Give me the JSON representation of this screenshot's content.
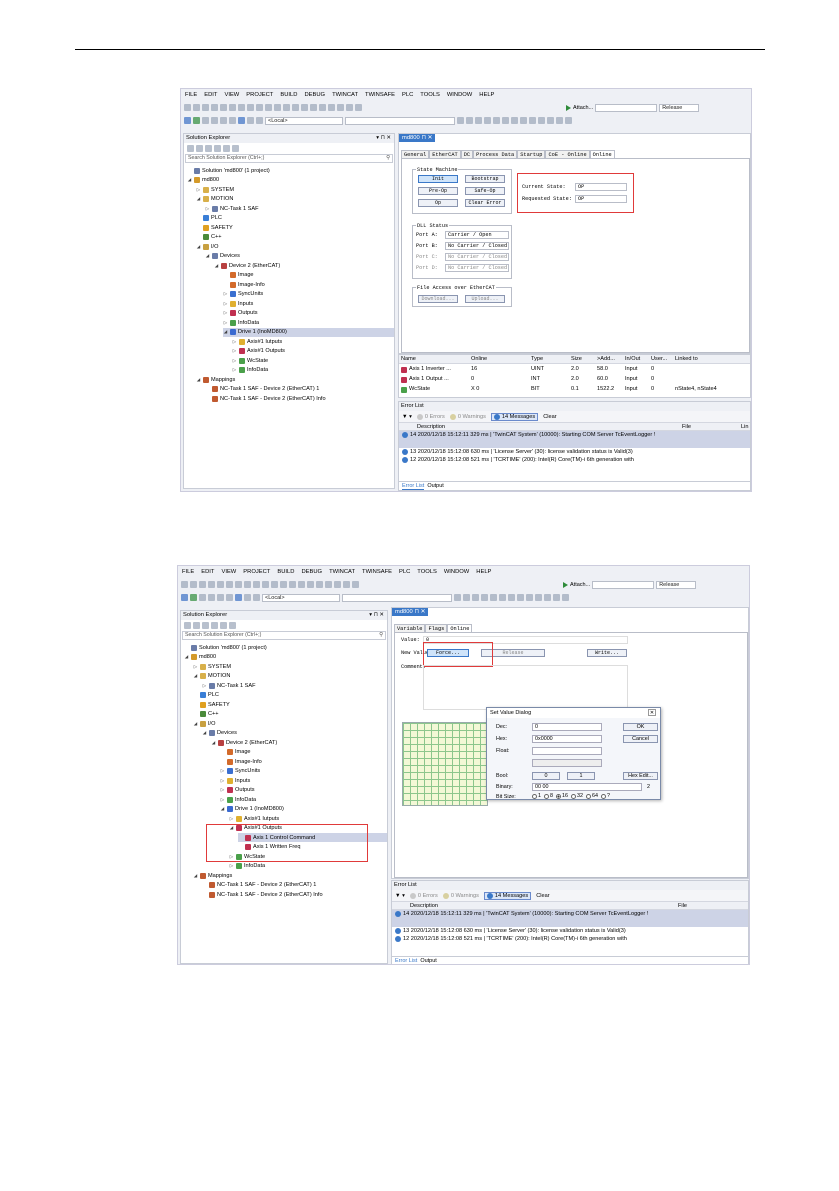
{
  "menu": [
    "FILE",
    "EDIT",
    "VIEW",
    "PROJECT",
    "BUILD",
    "DEBUG",
    "TWINCAT",
    "TWINSAFE",
    "PLC",
    "TOOLS",
    "WINDOW",
    "HELP"
  ],
  "toolbar": {
    "attach": "Attach...",
    "config": "Release",
    "local": "<Local>"
  },
  "solution_explorer": {
    "title": "Solution Explorer",
    "pin": "▾ ⊓ ✕",
    "search_placeholder": "Search Solution Explorer (Ctrl+;)"
  },
  "shot1": {
    "tree": [
      {
        "label": "Solution 'md800' (1 project)",
        "icon": "i-sol",
        "level": 0,
        "arrow": ""
      },
      {
        "label": "md800",
        "icon": "i-proj",
        "level": 0,
        "arrow": "◢"
      },
      {
        "label": "SYSTEM",
        "icon": "i-folder",
        "level": 1,
        "arrow": "▷"
      },
      {
        "label": "MOTION",
        "icon": "i-folder",
        "level": 1,
        "arrow": "◢"
      },
      {
        "label": "NC-Task 1 SAF",
        "icon": "i-sol",
        "level": 2,
        "arrow": "▷"
      },
      {
        "label": "PLC",
        "icon": "i-plc",
        "level": 1,
        "arrow": ""
      },
      {
        "label": "SAFETY",
        "icon": "i-safe",
        "level": 1,
        "arrow": ""
      },
      {
        "label": "C++",
        "icon": "i-cpp",
        "level": 1,
        "arrow": ""
      },
      {
        "label": "I/O",
        "icon": "i-io",
        "level": 1,
        "arrow": "◢"
      },
      {
        "label": "Devices",
        "icon": "i-sol",
        "level": 2,
        "arrow": "◢"
      },
      {
        "label": "Device 2 (EtherCAT)",
        "icon": "i-dev",
        "level": 3,
        "arrow": "◢"
      },
      {
        "label": "Image",
        "icon": "i-img",
        "level": 4,
        "arrow": ""
      },
      {
        "label": "Image-Info",
        "icon": "i-img",
        "level": 4,
        "arrow": ""
      },
      {
        "label": "SyncUnits",
        "icon": "i-sync",
        "level": 4,
        "arrow": "▷"
      },
      {
        "label": "Inputs",
        "icon": "i-in",
        "level": 4,
        "arrow": "▷"
      },
      {
        "label": "Outputs",
        "icon": "i-out",
        "level": 4,
        "arrow": "▷"
      },
      {
        "label": "InfoData",
        "icon": "i-info",
        "level": 4,
        "arrow": "▷"
      },
      {
        "label": "Drive 1 (InoMD800)",
        "icon": "i-drive",
        "level": 4,
        "arrow": "◢",
        "selected": true
      },
      {
        "label": "Axis#1 Iutputs",
        "icon": "i-in",
        "level": 5,
        "arrow": "▷"
      },
      {
        "label": "Axis#1 Outputs",
        "icon": "i-out",
        "level": 5,
        "arrow": "▷"
      },
      {
        "label": "WcState",
        "icon": "i-info",
        "level": 5,
        "arrow": "▷"
      },
      {
        "label": "InfoData",
        "icon": "i-info",
        "level": 5,
        "arrow": "▷"
      },
      {
        "label": "Mappings",
        "icon": "i-map",
        "level": 1,
        "arrow": "◢"
      },
      {
        "label": "NC-Task 1 SAF - Device 2 (EtherCAT) 1",
        "icon": "i-map",
        "level": 2,
        "arrow": ""
      },
      {
        "label": "NC-Task 1 SAF - Device 2 (EtherCAT) Info",
        "icon": "i-map",
        "level": 2,
        "arrow": ""
      }
    ],
    "doc_tab": "md800 ⊓ ✕",
    "tabs": [
      "General",
      "EtherCAT",
      "DC",
      "Process Data",
      "Startup",
      "CoE - Online",
      "Online"
    ],
    "state_machine": {
      "title": "State Machine",
      "buttons": [
        "Init",
        "Bootstrap",
        "Pre-Op",
        "Safe-Op",
        "Op",
        "Clear Error"
      ],
      "current_label": "Current State:",
      "current_value": "OP",
      "requested_label": "Requested State:",
      "requested_value": "OP"
    },
    "dll": {
      "title": "DLL Status",
      "rows": [
        {
          "port": "Port A:",
          "value": "Carrier / Open",
          "dis": false
        },
        {
          "port": "Port B:",
          "value": "No Carrier / Closed",
          "dis": false
        },
        {
          "port": "Port C:",
          "value": "No Carrier / Closed",
          "dis": true
        },
        {
          "port": "Port D:",
          "value": "No Carrier / Closed",
          "dis": true
        }
      ]
    },
    "foe": {
      "title": "File Access over EtherCAT",
      "download": "Download...",
      "upload": "Upload..."
    },
    "var_table": {
      "headers": [
        "Name",
        "Online",
        "Type",
        "Size",
        ">Add...",
        "In/Out",
        "User...",
        "Linked to"
      ],
      "rows": [
        [
          "Axis 1 Inverter ...",
          "16",
          "UINT",
          "2.0",
          "58.0",
          "Input",
          "0",
          ""
        ],
        [
          "Axis 1 Output ...",
          "0",
          "INT",
          "2.0",
          "60.0",
          "Input",
          "0",
          ""
        ],
        [
          "WcState",
          "X  0",
          "BIT",
          "0.1",
          "1522.2",
          "Input",
          "0",
          "nState4, nState4"
        ]
      ]
    },
    "errors": {
      "title": "Error List",
      "errors": "0 Errors",
      "warnings": "0 Warnings",
      "messages": "14 Messages",
      "clear": "Clear",
      "col_desc": "Description",
      "col_file": "File",
      "col_line": "Lin",
      "msgs": [
        "14 2020/12/18 15:12:11 329 ms | 'TwinCAT System' (10000): Starting COM Server TcEventLogger !",
        "13 2020/12/18 15:12:08 630 ms | 'License Server' (30): license validation status is Valid(3)",
        "12 2020/12/18 15:12:08 521 ms | 'TCRTIME' (200): Intel(R) Core(TM)-i 6th generation with"
      ],
      "tab_error": "Error List",
      "tab_output": "Output"
    }
  },
  "shot2": {
    "tree": [
      {
        "label": "Solution 'md800' (1 project)",
        "icon": "i-sol",
        "level": 0,
        "arrow": ""
      },
      {
        "label": "md800",
        "icon": "i-proj",
        "level": 0,
        "arrow": "◢"
      },
      {
        "label": "SYSTEM",
        "icon": "i-folder",
        "level": 1,
        "arrow": "▷"
      },
      {
        "label": "MOTION",
        "icon": "i-folder",
        "level": 1,
        "arrow": "◢"
      },
      {
        "label": "NC-Task 1 SAF",
        "icon": "i-sol",
        "level": 2,
        "arrow": "▷"
      },
      {
        "label": "PLC",
        "icon": "i-plc",
        "level": 1,
        "arrow": ""
      },
      {
        "label": "SAFETY",
        "icon": "i-safe",
        "level": 1,
        "arrow": ""
      },
      {
        "label": "C++",
        "icon": "i-cpp",
        "level": 1,
        "arrow": ""
      },
      {
        "label": "I/O",
        "icon": "i-io",
        "level": 1,
        "arrow": "◢"
      },
      {
        "label": "Devices",
        "icon": "i-sol",
        "level": 2,
        "arrow": "◢"
      },
      {
        "label": "Device 2 (EtherCAT)",
        "icon": "i-dev",
        "level": 3,
        "arrow": "◢"
      },
      {
        "label": "Image",
        "icon": "i-img",
        "level": 4,
        "arrow": ""
      },
      {
        "label": "Image-Info",
        "icon": "i-img",
        "level": 4,
        "arrow": ""
      },
      {
        "label": "SyncUnits",
        "icon": "i-sync",
        "level": 4,
        "arrow": "▷"
      },
      {
        "label": "Inputs",
        "icon": "i-in",
        "level": 4,
        "arrow": "▷"
      },
      {
        "label": "Outputs",
        "icon": "i-out",
        "level": 4,
        "arrow": "▷"
      },
      {
        "label": "InfoData",
        "icon": "i-info",
        "level": 4,
        "arrow": "▷"
      },
      {
        "label": "Drive 1 (InoMD800)",
        "icon": "i-drive",
        "level": 4,
        "arrow": "◢"
      },
      {
        "label": "Axis#1 Iutputs",
        "icon": "i-in",
        "level": 5,
        "arrow": "▷"
      },
      {
        "label": "Axis#1 Outputs",
        "icon": "i-out",
        "level": 5,
        "arrow": "◢"
      },
      {
        "label": "Axis 1 Control Command",
        "icon": "i-out",
        "level": 6,
        "arrow": "",
        "selected": true
      },
      {
        "label": "Axis 1 Written Freq",
        "icon": "i-out",
        "level": 6,
        "arrow": ""
      },
      {
        "label": "WcState",
        "icon": "i-info",
        "level": 5,
        "arrow": "▷"
      },
      {
        "label": "InfoData",
        "icon": "i-info",
        "level": 5,
        "arrow": "▷"
      },
      {
        "label": "Mappings",
        "icon": "i-map",
        "level": 1,
        "arrow": "◢"
      },
      {
        "label": "NC-Task 1 SAF - Device 2 (EtherCAT) 1",
        "icon": "i-map",
        "level": 2,
        "arrow": ""
      },
      {
        "label": "NC-Task 1 SAF - Device 2 (EtherCAT) Info",
        "icon": "i-map",
        "level": 2,
        "arrow": ""
      }
    ],
    "doc_tab": "md800 ⊓ ✕",
    "tabs": [
      "Variable",
      "Flags",
      "Online"
    ],
    "value_label": "Value:",
    "value": "0",
    "new_value_label": "New Value:",
    "force": "Force...",
    "release": "Release",
    "write": "Write...",
    "comment_label": "Comment:",
    "dialog": {
      "title": "Set Value Dialog",
      "close": "✕",
      "dec_label": "Dec:",
      "dec": "0",
      "ok": "OK",
      "hex_label": "Hex:",
      "hex": "0x0000",
      "cancel": "Cancel",
      "float_label": "Float:",
      "bool_label": "Bool:",
      "b0": "0",
      "b1": "1",
      "hexedit": "Hex Edit...",
      "binary_label": "Binary:",
      "binary": "00 00",
      "binary_size": "2",
      "bitsize_label": "Bit Size:",
      "bitsizes": [
        "1",
        "8",
        "16",
        "32",
        "64",
        "?"
      ]
    },
    "errors": {
      "title": "Error List",
      "errors": "0 Errors",
      "warnings": "0 Warnings",
      "messages": "14 Messages",
      "clear": "Clear",
      "col_desc": "Description",
      "col_file": "File",
      "msgs": [
        "14 2020/12/18 15:12:11 329 ms | 'TwinCAT System' (10000): Starting COM Server TcEventLogger !",
        "13 2020/12/18 15:12:08 630 ms | 'License Server' (30): license validation status is Valid(3)",
        "12 2020/12/18 15:12:08 521 ms | 'TCRTIME' (200): Intel(R) Core(TM)-i 6th generation with"
      ],
      "tab_error": "Error List",
      "tab_output": "Output"
    }
  },
  "colors": {
    "accent": "#3a78c8",
    "highlight_box": "#e03a3a",
    "selection": "#cdd3e6"
  }
}
